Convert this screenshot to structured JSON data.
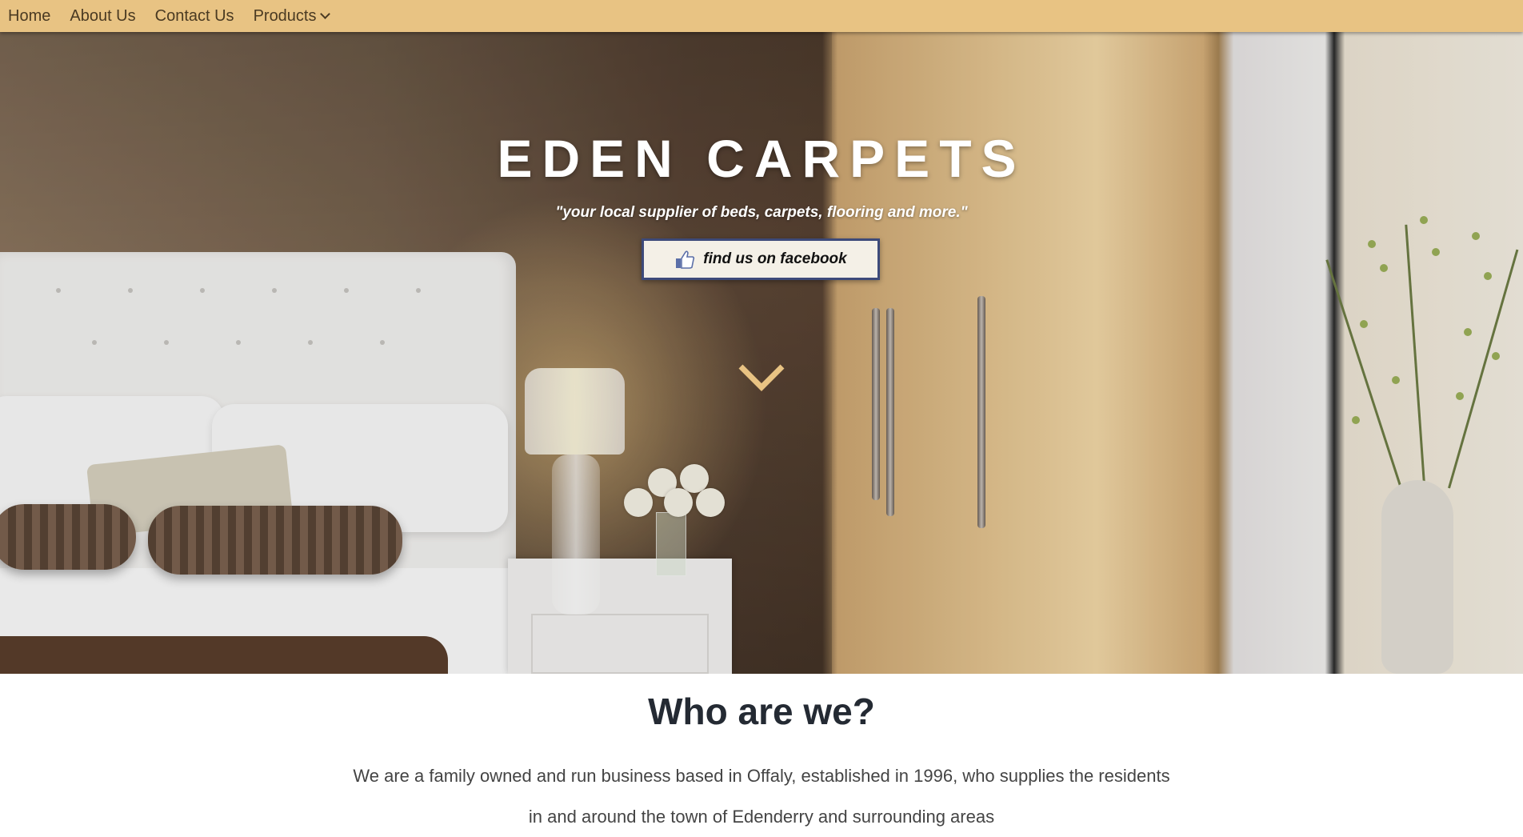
{
  "nav": {
    "items": [
      {
        "label": "Home"
      },
      {
        "label": "About Us"
      },
      {
        "label": "Contact Us"
      },
      {
        "label": "Products"
      }
    ],
    "dropdown_icon": "chevron-down-icon"
  },
  "hero": {
    "title": "EDEN CARPETS",
    "tagline": "\"your local supplier of beds, carpets, flooring and more.\"",
    "facebook_button": {
      "label": "find us on facebook",
      "icon": "thumbs-up-icon"
    },
    "scroll_icon": "chevron-down-icon",
    "accent_color": "#e8c383"
  },
  "about": {
    "title": "Who are we?",
    "text": "We are a family owned and run business based in Offaly, established in 1996, who supplies the residents in and around the town of Edenderry and surrounding areas"
  }
}
